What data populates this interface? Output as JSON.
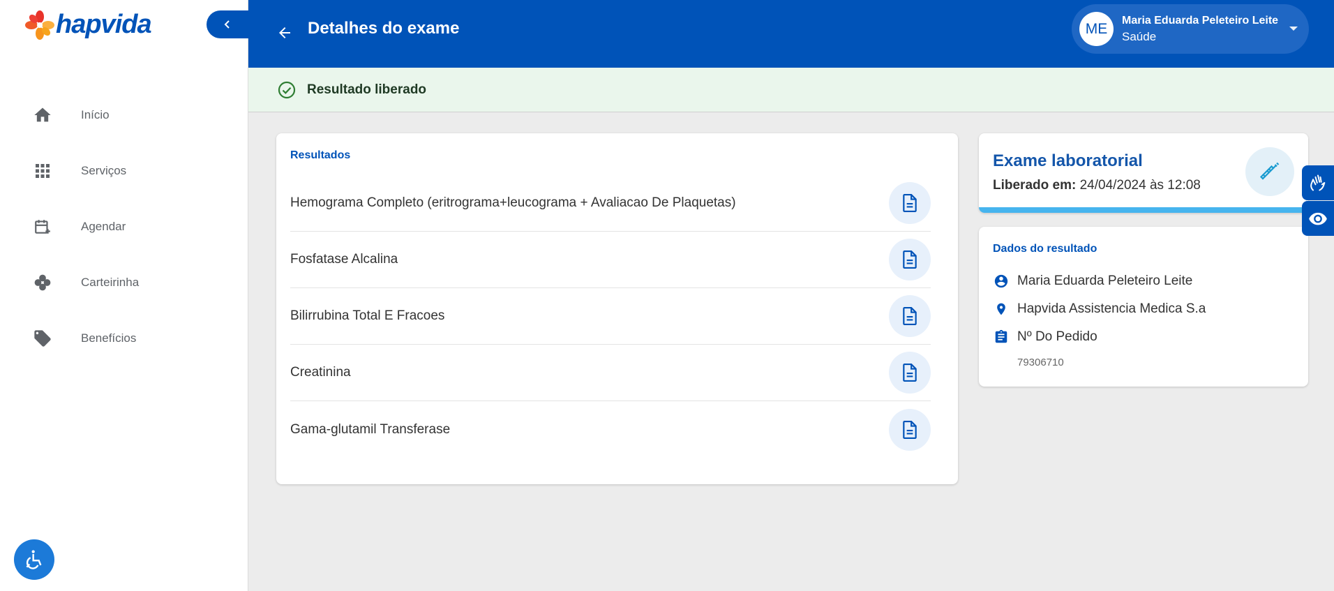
{
  "brand": {
    "name": "hapvida",
    "primary_color": "#0053b8",
    "accent_colors": [
      "#e8332a",
      "#f7941d",
      "#fbb040"
    ]
  },
  "sidebar": {
    "collapse_icon": "chevron-left-icon",
    "items": [
      {
        "label": "Início",
        "icon": "home-icon"
      },
      {
        "label": "Serviços",
        "icon": "apps-grid-icon"
      },
      {
        "label": "Agendar",
        "icon": "calendar-add-icon"
      },
      {
        "label": "Carteirinha",
        "icon": "clover-icon"
      },
      {
        "label": "Benefícios",
        "icon": "tag-icon"
      }
    ],
    "accessibility_icon": "wheelchair-icon"
  },
  "header": {
    "title": "Detalhes do exame",
    "back_icon": "arrow-left-icon",
    "user": {
      "initials": "ME",
      "name": "Maria Eduarda Peleteiro Leite",
      "plan": "Saúde"
    }
  },
  "status": {
    "text": "Resultado liberado",
    "icon": "check-circle-icon",
    "color": "#2e7d32"
  },
  "results": {
    "heading": "Resultados",
    "items": [
      {
        "name": "Hemograma Completo (eritrograma+leucograma + Avaliacao De Plaquetas)"
      },
      {
        "name": "Fosfatase Alcalina"
      },
      {
        "name": "Bilirrubina Total E Fracoes"
      },
      {
        "name": "Creatinina"
      },
      {
        "name": "Gama-glutamil Transferase"
      }
    ],
    "item_icon": "document-icon"
  },
  "exam": {
    "title": "Exame laboratorial",
    "released_label": "Liberado em:",
    "released_value": "24/04/2024 às 12:08",
    "icon": "syringe-icon"
  },
  "result_data": {
    "heading": "Dados do resultado",
    "patient": "Maria Eduarda Peleteiro Leite",
    "provider": "Hapvida Assistencia Medica S.a",
    "order_label": "Nº Do Pedido",
    "order_number": "79306710"
  },
  "floating_buttons": [
    {
      "icon": "sign-language-icon"
    },
    {
      "icon": "eye-icon"
    }
  ]
}
